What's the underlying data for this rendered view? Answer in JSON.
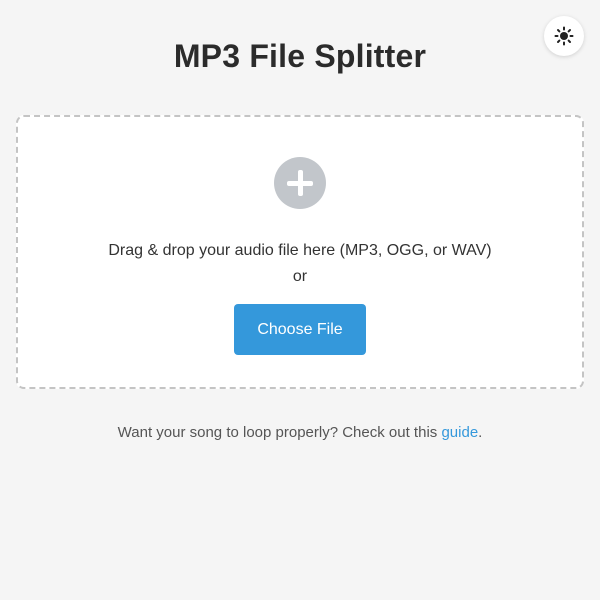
{
  "header": {
    "title": "MP3 File Splitter",
    "theme_toggle_icon": "sun-icon"
  },
  "dropzone": {
    "add_icon": "plus-circle-icon",
    "instruction": "Drag & drop your audio file here (MP3, OGG, or WAV)",
    "or_label": "or",
    "choose_button_label": "Choose File"
  },
  "footer": {
    "text_before": "Want your song to loop properly? Check out this ",
    "link_label": "guide",
    "text_after": "."
  },
  "colors": {
    "background": "#f5f5f5",
    "accent": "#3498db",
    "icon_gray": "#c2c6cb",
    "dashed_border": "#c4c4c4"
  }
}
